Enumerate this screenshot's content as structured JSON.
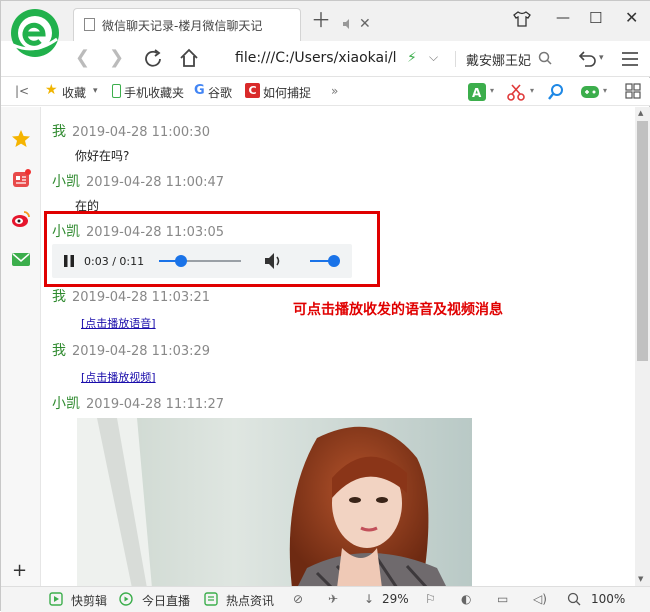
{
  "tab": {
    "title": "微信聊天记录-楼月微信聊天记"
  },
  "navbar": {
    "url": "file:///C:/Users/xiaokai/l",
    "search_text": "戴安娜王妃"
  },
  "bookmarks": [
    {
      "label": "收藏"
    },
    {
      "label": "手机收藏夹"
    },
    {
      "label": "谷歌"
    },
    {
      "label": "如何捕捉"
    }
  ],
  "messages": [
    {
      "sender": "我",
      "time": "2019-04-28 11:00:30",
      "text": "你好在吗?"
    },
    {
      "sender": "小凯",
      "time": "2019-04-28 11:00:47",
      "text": "在的"
    },
    {
      "sender": "小凯",
      "time": "2019-04-28 11:03:05"
    },
    {
      "sender": "我",
      "time": "2019-04-28 11:03:21",
      "link": "[点击播放语音]"
    },
    {
      "sender": "我",
      "time": "2019-04-28 11:03:29",
      "link": "[点击播放视频]"
    },
    {
      "sender": "小凯",
      "time": "2019-04-28 11:11:27"
    }
  ],
  "player": {
    "time": "0:03 / 0:11",
    "progress": 0.27,
    "volume": 1.0
  },
  "annotation": "可点击播放收发的语音及视频消息",
  "statusbar": {
    "items": [
      "快剪辑",
      "今日直播",
      "热点资讯"
    ],
    "download_pct": "29%",
    "zoom": "100%"
  },
  "colors": {
    "accent_green": "#2f8a2f",
    "annotation_red": "#e00000",
    "player_blue": "#1a73e8"
  }
}
